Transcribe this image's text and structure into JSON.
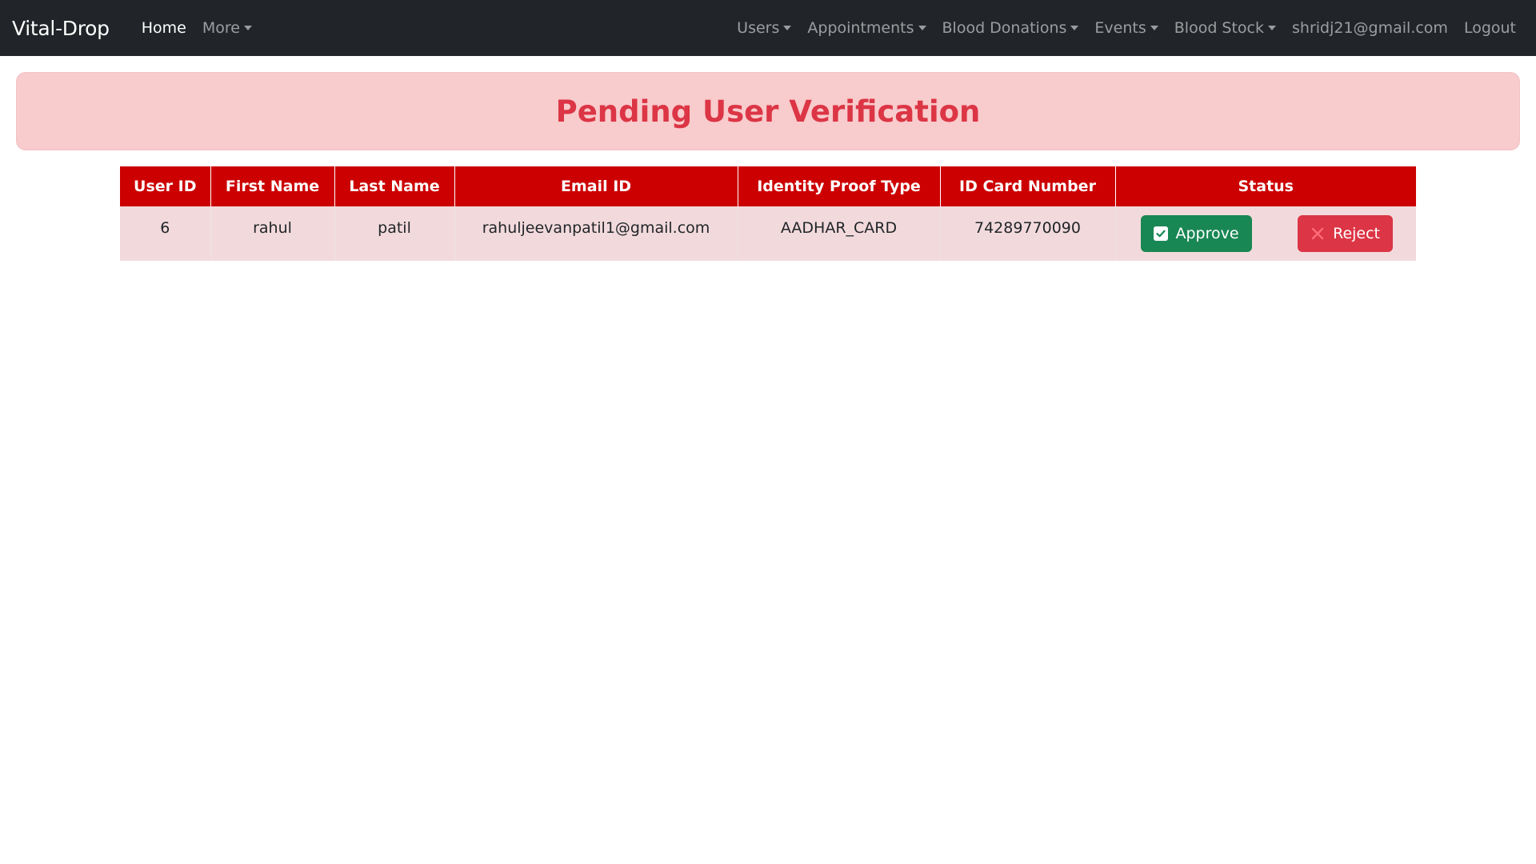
{
  "nav": {
    "brand": "Vital-Drop",
    "left": [
      {
        "label": "Home",
        "dropdown": false,
        "active": true
      },
      {
        "label": "More",
        "dropdown": true,
        "active": false
      }
    ],
    "right": [
      {
        "label": "Users",
        "dropdown": true
      },
      {
        "label": "Appointments",
        "dropdown": true
      },
      {
        "label": "Blood Donations",
        "dropdown": true
      },
      {
        "label": "Events",
        "dropdown": true
      },
      {
        "label": "Blood Stock",
        "dropdown": true
      },
      {
        "label": "shridj21@gmail.com",
        "dropdown": false
      },
      {
        "label": "Logout",
        "dropdown": false
      }
    ]
  },
  "banner": {
    "title": "Pending User Verification"
  },
  "table": {
    "headers": [
      "User ID",
      "First Name",
      "Last Name",
      "Email ID",
      "Identity Proof Type",
      "ID Card Number",
      "Status"
    ],
    "rows": [
      {
        "user_id": "6",
        "first_name": "rahul",
        "last_name": "patil",
        "email": "rahuljeevanpatil1@gmail.com",
        "id_proof_type": "AADHAR_CARD",
        "id_card_number": "74289770090",
        "approve_label": "Approve",
        "reject_label": "Reject"
      }
    ]
  },
  "icons": {
    "approve": "check-square-icon",
    "reject": "x-icon",
    "dropdown": "caret-down-icon"
  },
  "colors": {
    "navbar": "#212529",
    "banner_bg": "#f8cbcc",
    "title": "#dc3545",
    "table_header": "#cc0000",
    "row_bg": "#f2dadc",
    "approve": "#198754",
    "reject": "#dc3545"
  }
}
